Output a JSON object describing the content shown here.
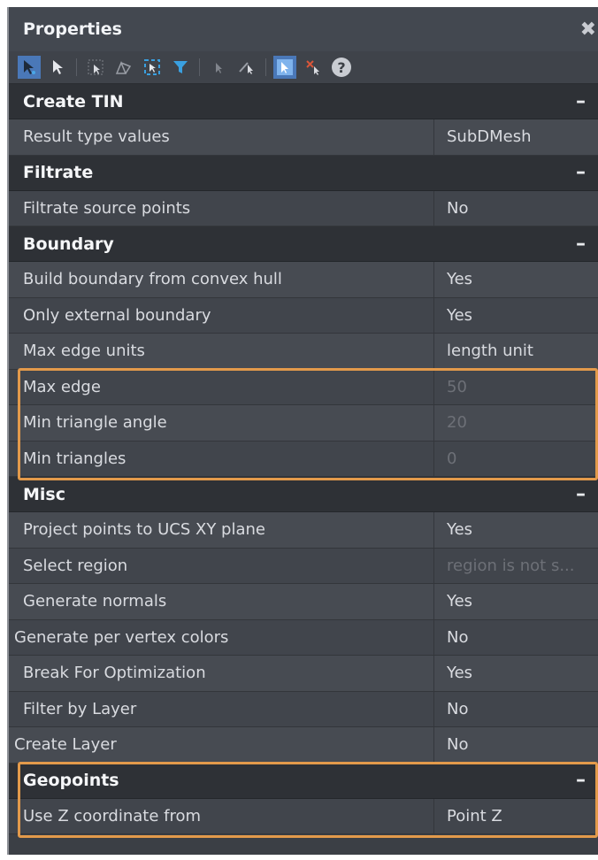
{
  "panel": {
    "title": "Properties",
    "close_glyph": "✖",
    "help_glyph": "?"
  },
  "sections": [
    {
      "title": "Create TIN",
      "collapse": "–",
      "rows": [
        {
          "label": "Result type values",
          "value": "SubDMesh"
        }
      ]
    },
    {
      "title": "Filtrate",
      "collapse": "–",
      "rows": [
        {
          "label": "Filtrate source points",
          "value": "No"
        }
      ]
    },
    {
      "title": "Boundary",
      "collapse": "–",
      "rows": [
        {
          "label": "Build boundary from convex hull",
          "value": "Yes"
        },
        {
          "label": "Only external boundary",
          "value": "Yes"
        },
        {
          "label": "Max edge units",
          "value": "length unit"
        },
        {
          "label": "Max edge",
          "value": "50"
        },
        {
          "label": "Min triangle angle",
          "value": "20"
        },
        {
          "label": "Min triangles",
          "value": "0"
        }
      ]
    },
    {
      "title": "Misc",
      "collapse": "–",
      "rows": [
        {
          "label": "Project points to UCS XY plane",
          "value": "Yes"
        },
        {
          "label": "Select region",
          "value": "region is not s..."
        },
        {
          "label": "Generate normals",
          "value": "Yes"
        },
        {
          "label": "Generate per vertex colors",
          "value": "No"
        },
        {
          "label": "Break For Optimization",
          "value": "Yes"
        },
        {
          "label": "Filter by Layer",
          "value": "No"
        },
        {
          "label": "Create Layer",
          "value": "No"
        }
      ]
    },
    {
      "title": "Geopoints",
      "collapse": "–",
      "rows": [
        {
          "label": "Use Z coordinate from",
          "value": "Point Z"
        }
      ]
    }
  ],
  "colors": {
    "panel_bg": "#3b3f45",
    "section_bg": "#2e3136",
    "highlight": "#e39a4b",
    "active_button": "#4a78b8"
  }
}
